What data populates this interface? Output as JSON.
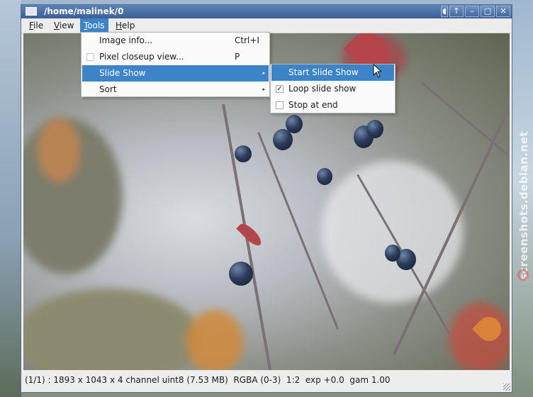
{
  "window": {
    "title": "/home/malinek/0"
  },
  "title_buttons": [
    "◖",
    "↑",
    "–",
    "□",
    "✕"
  ],
  "menubar": [
    {
      "label": "File",
      "mnemonic": "F"
    },
    {
      "label": "View",
      "mnemonic": "V"
    },
    {
      "label": "Tools",
      "mnemonic": "T",
      "active": true
    },
    {
      "label": "Help",
      "mnemonic": "H"
    }
  ],
  "tools_menu": {
    "items": [
      {
        "label": "Image info...",
        "accel": "Ctrl+I"
      },
      {
        "label": "Pixel closeup view...",
        "accel": "P",
        "checkbox": false
      },
      {
        "label": "Slide Show",
        "submenu": true,
        "highlighted": true
      },
      {
        "label": "Sort",
        "submenu": true
      }
    ]
  },
  "slideshow_menu": {
    "items": [
      {
        "label": "Start Slide Show",
        "highlighted": true
      },
      {
        "label": "Loop slide show",
        "checked": true
      },
      {
        "label": "Stop at end",
        "checked": false
      }
    ]
  },
  "status": {
    "text": "(1/1) : 1893 x 1043 x 4 channel uint8 (7.53 MB)  RGBA (0-3)  1:2  exp +0.0  gam 1.00"
  },
  "watermark": {
    "text": "screenshots.debian.net"
  },
  "icons": {
    "submenu_arrow": "▸",
    "check": "✓"
  }
}
